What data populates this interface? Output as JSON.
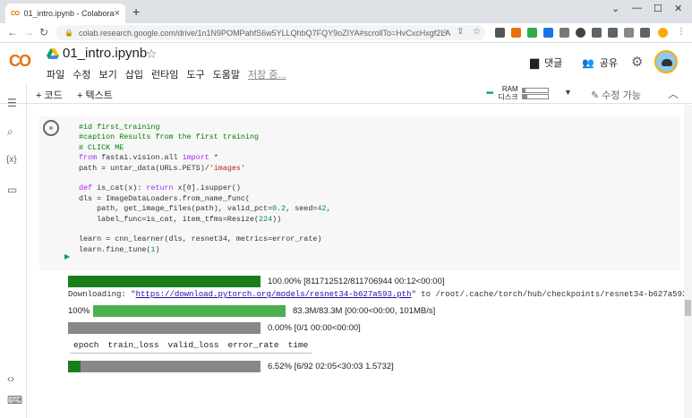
{
  "browser": {
    "tab_title": "01_intro.ipynb - Colaboratory",
    "tab_favicon": "CO",
    "url": "colab.research.google.com/drive/1n1N9POMPahfS6w5YLLQhbQ7FQY9oZIYA#scrollTo=HvCxcHxgf2LA"
  },
  "header": {
    "notebook_name": "01_intro.ipynb",
    "logo_text": "CO",
    "menu": [
      "파일",
      "수정",
      "보기",
      "삽입",
      "런타임",
      "도구",
      "도움말"
    ],
    "saving_status": "저장 중...",
    "comment_label": "댓글",
    "share_label": "공유"
  },
  "subbar": {
    "add_code": "+ 코드",
    "add_text": "+ 텍스트",
    "ram_label": "RAM",
    "disk_label": "디스크",
    "ram_fill": 0.12,
    "disk_fill": 0.18,
    "edit_mode": "수정 가능"
  },
  "cell": {
    "code_lines": [
      [
        {
          "c": "cm",
          "t": "#id first_training"
        }
      ],
      [
        {
          "c": "cm",
          "t": "#caption Results from the first training"
        }
      ],
      [
        {
          "c": "cm",
          "t": "# CLICK ME"
        }
      ],
      [
        {
          "c": "kw",
          "t": "from"
        },
        {
          "c": "",
          "t": " fastai.vision.all "
        },
        {
          "c": "kw",
          "t": "import"
        },
        {
          "c": "",
          "t": " *"
        }
      ],
      [
        {
          "c": "",
          "t": "path = untar_data(URLs.PETS)/"
        },
        {
          "c": "st",
          "t": "'images'"
        }
      ],
      [
        {
          "c": "",
          "t": ""
        }
      ],
      [
        {
          "c": "kw",
          "t": "def"
        },
        {
          "c": "",
          "t": " is_cat(x): "
        },
        {
          "c": "kw",
          "t": "return"
        },
        {
          "c": "",
          "t": " x[0].isupper()"
        }
      ],
      [
        {
          "c": "",
          "t": "dls = ImageDataLoaders.from_name_func("
        }
      ],
      [
        {
          "c": "",
          "t": "    path, get_image_files(path), valid_pct="
        },
        {
          "c": "nm",
          "t": "0.2"
        },
        {
          "c": "",
          "t": ", seed="
        },
        {
          "c": "nm",
          "t": "42"
        },
        {
          "c": "",
          "t": ","
        }
      ],
      [
        {
          "c": "",
          "t": "    label_func=is_cat, item_tfms=Resize("
        },
        {
          "c": "nm",
          "t": "224"
        },
        {
          "c": "",
          "t": "))"
        }
      ],
      [
        {
          "c": "",
          "t": ""
        }
      ],
      [
        {
          "c": "",
          "t": "learn = cnn_learner(dls, resnet34, metrics=error_rate)"
        }
      ],
      [
        {
          "c": "",
          "t": "learn.fine_tune("
        },
        {
          "c": "nm",
          "t": "1"
        },
        {
          "c": "",
          "t": ")"
        }
      ]
    ]
  },
  "output": {
    "bar1": {
      "fill": 1.0,
      "text": "100.00% [811712512/811706944 00:12<00:00]"
    },
    "downloading_prefix": "Downloading: \"",
    "download_url": "https://download.pytorch.org/models/resnet34-b627a593.pth",
    "downloading_suffix": "\" to /root/.cache/torch/hub/checkpoints/resnet34-b627a593.pth",
    "bar2": {
      "fill": 1.0,
      "left_text": "100%",
      "text": "83.3M/83.3M [00:00<00:00, 101MB/s]"
    },
    "bar3": {
      "fill": 0.0,
      "text": "0.00% [0/1 00:00<00:00]"
    },
    "metrics_headers": [
      "epoch",
      "train_loss",
      "valid_loss",
      "error_rate",
      "time"
    ],
    "bar4": {
      "fill": 0.0652,
      "text": "6.52% [6/92 02:05<30:03 1.5732]"
    }
  },
  "colors": {
    "progress_dark": "#1a7f1a",
    "progress_light": "#4caf50",
    "accent": "#f9ab00"
  }
}
